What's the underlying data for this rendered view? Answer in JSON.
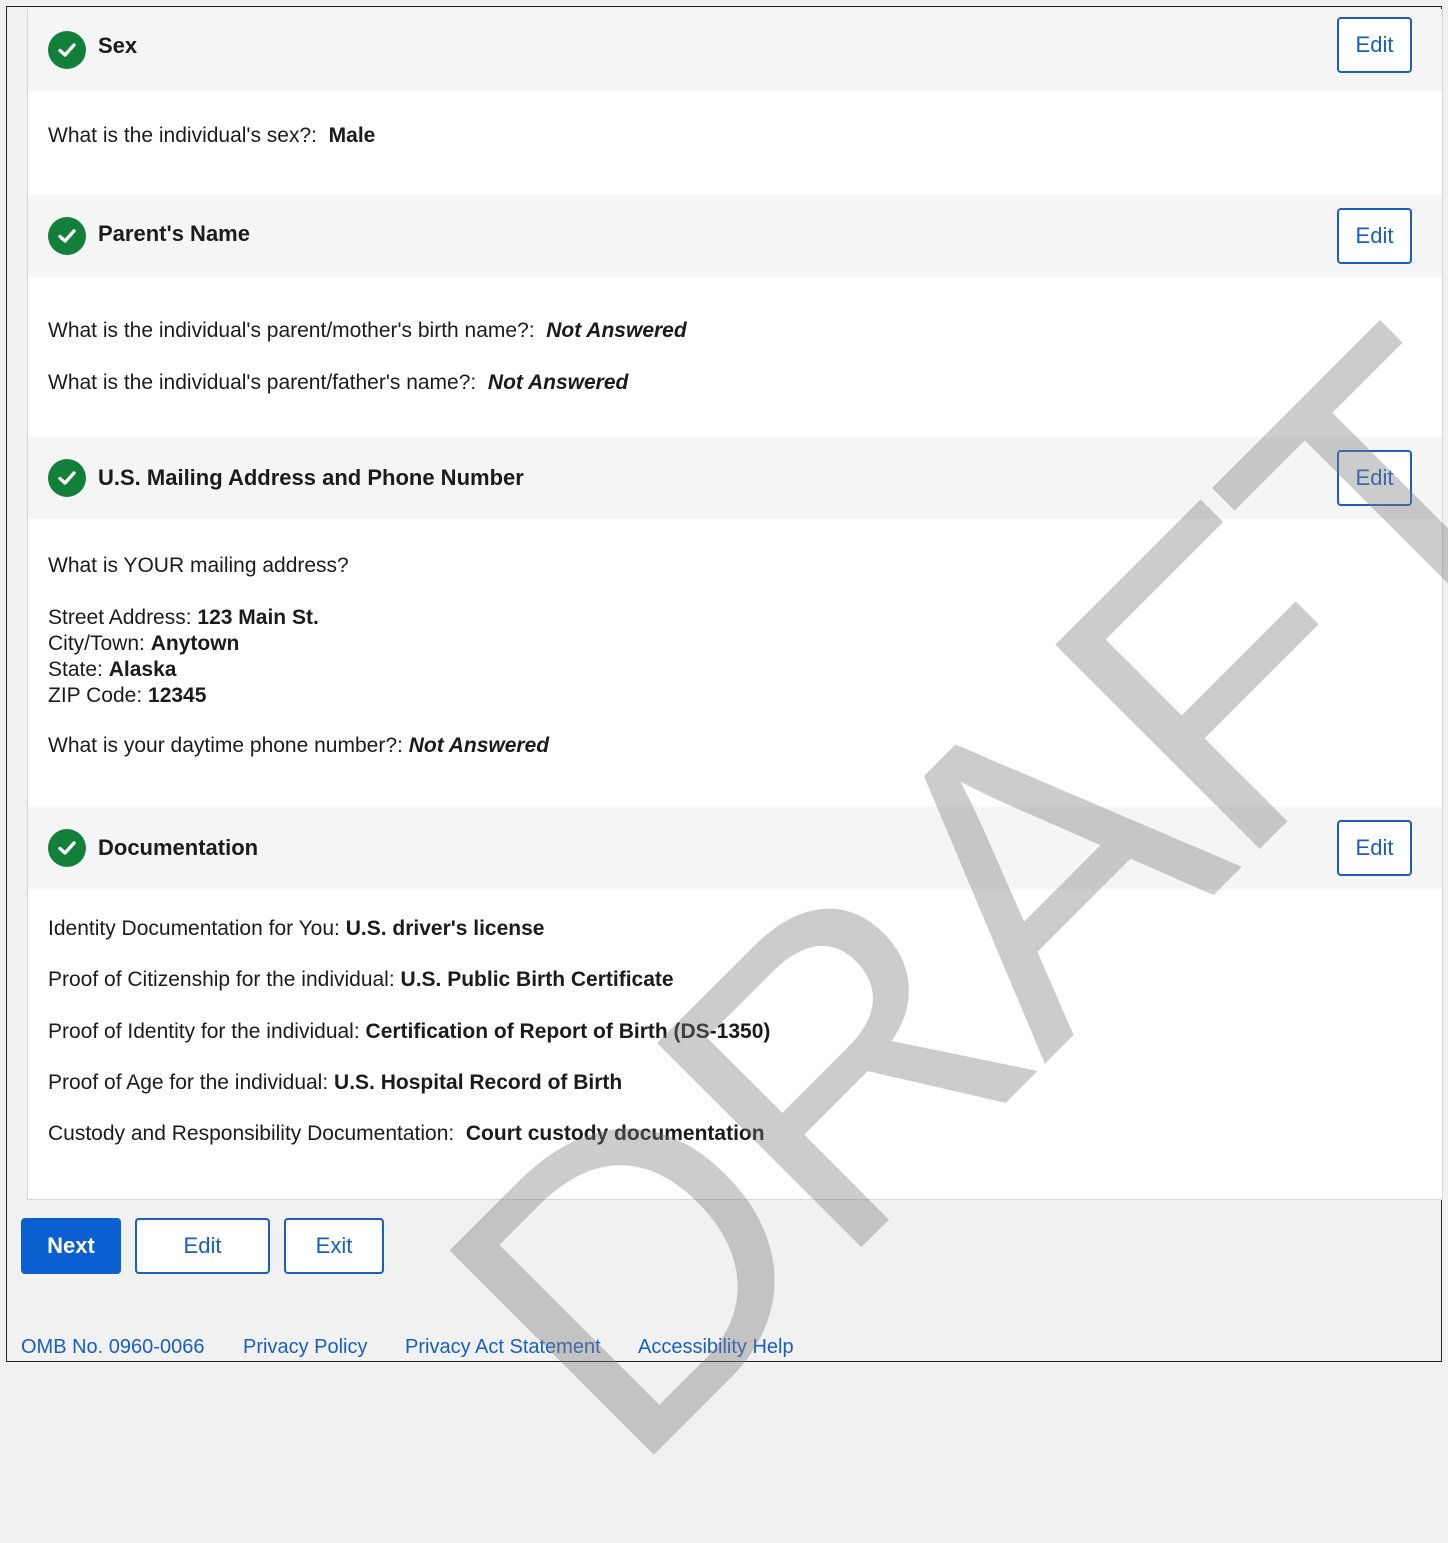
{
  "sections": [
    {
      "title": "Sex",
      "edit_label": "Edit",
      "lines": [
        {
          "label": "What is the individual's sex?:",
          "value": "Male"
        }
      ]
    },
    {
      "title": "Parent's Name",
      "edit_label": "Edit",
      "lines": [
        {
          "label": "What is the individual's parent/mother's birth name?:",
          "value": "Not Answered"
        },
        {
          "label": "What is the individual's parent/father's name?:",
          "value": "Not Answered"
        }
      ]
    },
    {
      "title": "U.S. Mailing Address and Phone Number",
      "edit_label": "Edit",
      "question": "What is YOUR mailing address?",
      "address": [
        {
          "label": "Street Address:",
          "value": "123 Main St."
        },
        {
          "label": "City/Town:",
          "value": "Anytown"
        },
        {
          "label": "State:",
          "value": "Alaska"
        },
        {
          "label": "ZIP Code:",
          "value": "12345"
        }
      ],
      "phone": {
        "label": "What is your daytime phone number?:",
        "value": "Not Answered"
      }
    },
    {
      "title": "Documentation",
      "edit_label": "Edit",
      "lines": [
        {
          "label": "Identity Documentation for You:",
          "value": "U.S. driver's license"
        },
        {
          "label": "Proof of Citizenship for the individual:",
          "value": "U.S. Public Birth Certificate"
        },
        {
          "label": "Proof of Identity for the individual:",
          "value": "Certification of Report of Birth (DS-1350)"
        },
        {
          "label": "Proof of Age for the individual:",
          "value": "U.S. Hospital Record of Birth"
        },
        {
          "label": "Custody and Responsibility Documentation:",
          "value": "Court custody documentation"
        }
      ]
    }
  ],
  "actions": {
    "next": "Next",
    "edit": "Edit",
    "exit": "Exit"
  },
  "footer": {
    "omb": "OMB No. 0960-0066",
    "privacy_policy": "Privacy Policy",
    "privacy_act": "Privacy Act Statement",
    "accessibility": "Accessibility Help"
  },
  "watermark": "DRAFT",
  "icons": {
    "section_status": "check-circle-icon"
  },
  "colors": {
    "check": "#12803a",
    "primary": "#0b5fd1",
    "link": "#1a5fbf"
  }
}
